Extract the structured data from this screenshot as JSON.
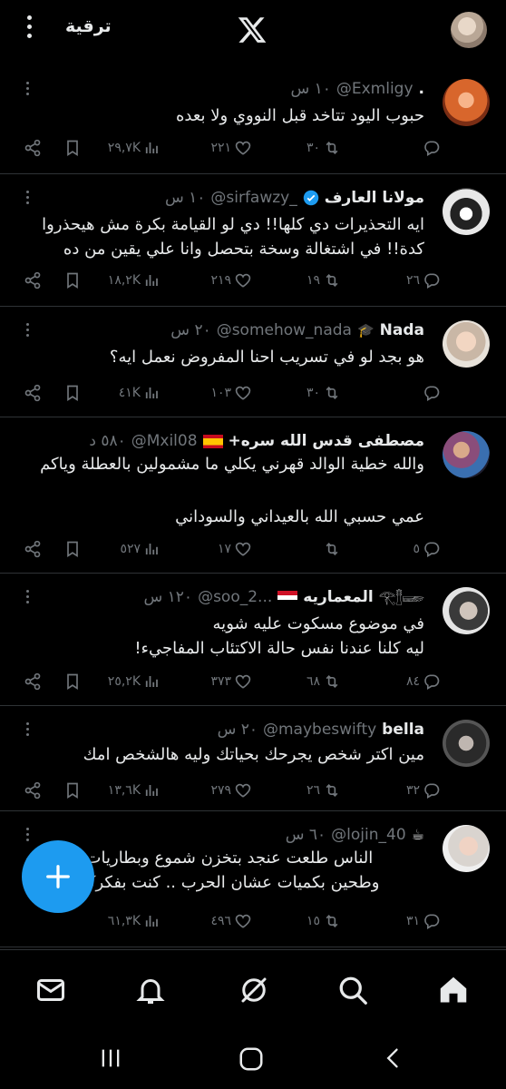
{
  "topbar": {
    "upgrade_label": "ترقية"
  },
  "tweets": [
    {
      "name": ".",
      "handle": "@Exmligy",
      "time": "١٠ س",
      "lines": [
        "حبوب اليود تتاخد قبل النووي ولا بعده"
      ],
      "replies": "",
      "reposts": "٣٠",
      "likes": "٢٢١",
      "views": "٢٩,٧K"
    },
    {
      "name": "مولانا العارف",
      "handle": "@sirfawzy_",
      "time": "١٠ س",
      "lines": [
        "ايه التحذيرات دي كلها!! دي لو القيامة بكرة مش هيحذروا",
        "كدة!! في اشتغالة وسخة بتحصل وانا علي يقين من ده"
      ],
      "replies": "٢٦",
      "reposts": "١٩",
      "likes": "٢١٩",
      "views": "١٨,٢K"
    },
    {
      "name": "Nada",
      "handle": "@somehow_nada",
      "time": "٢٠ س",
      "lines": [
        "هو بجد لو في تسريب احنا المفروض نعمل ايه؟"
      ],
      "replies": "",
      "reposts": "٣٠",
      "likes": "١٠٣",
      "views": "٤١K"
    },
    {
      "name": "مصطفى قدس الله سره+",
      "handle": "@Mxil08",
      "time": "٥٨٠ د",
      "lines": [
        "والله خطية الوالد قهرني يكلي ما مشمولين بالعطلة وياكم",
        "",
        "عمي حسبي الله بالعيداني والسوداني"
      ],
      "replies": "٥",
      "reposts": "",
      "likes": "١٧",
      "views": "٥٢٧"
    },
    {
      "name": "المعماريه",
      "handle": "@soo_2...",
      "time": "١٢٠ س",
      "lines": [
        "في موضوع مسكوت عليه شويه",
        "ليه كلنا عندنا نفس حالة الاكتئاب المفاجيء!"
      ],
      "replies": "٨٤",
      "reposts": "٦٨",
      "likes": "٣٧٣",
      "views": "٢٥,٢K"
    },
    {
      "name": "bella",
      "handle": "@maybeswifty",
      "time": "٢٠ س",
      "lines": [
        "مين اكتر شخص يجرحك بحياتك وليه هالشخص امك"
      ],
      "replies": "٣٢",
      "reposts": "٢٦",
      "likes": "٢٧٩",
      "views": "١٣,٦K"
    },
    {
      "name": "",
      "handle": "@lojin_40",
      "time": "٦٠ س",
      "lines": [
        "الناس طلعت عنجد بتخزن شموع وبطاريات ومعلبات",
        "وطحين بكميات عشان الحرب .. كنت بفكركم بتمزحو"
      ],
      "replies": "٣١",
      "reposts": "١٥",
      "likes": "٤٩٦",
      "views": "٦١,٣K"
    }
  ],
  "colors": {
    "accent": "#1d9bf0",
    "muted": "#71767b",
    "text": "#e7e9ea",
    "background": "#000000"
  },
  "bottomnav": {
    "items": [
      "home-icon",
      "search-icon",
      "grok-icon",
      "notifications-icon",
      "messages-icon"
    ]
  }
}
